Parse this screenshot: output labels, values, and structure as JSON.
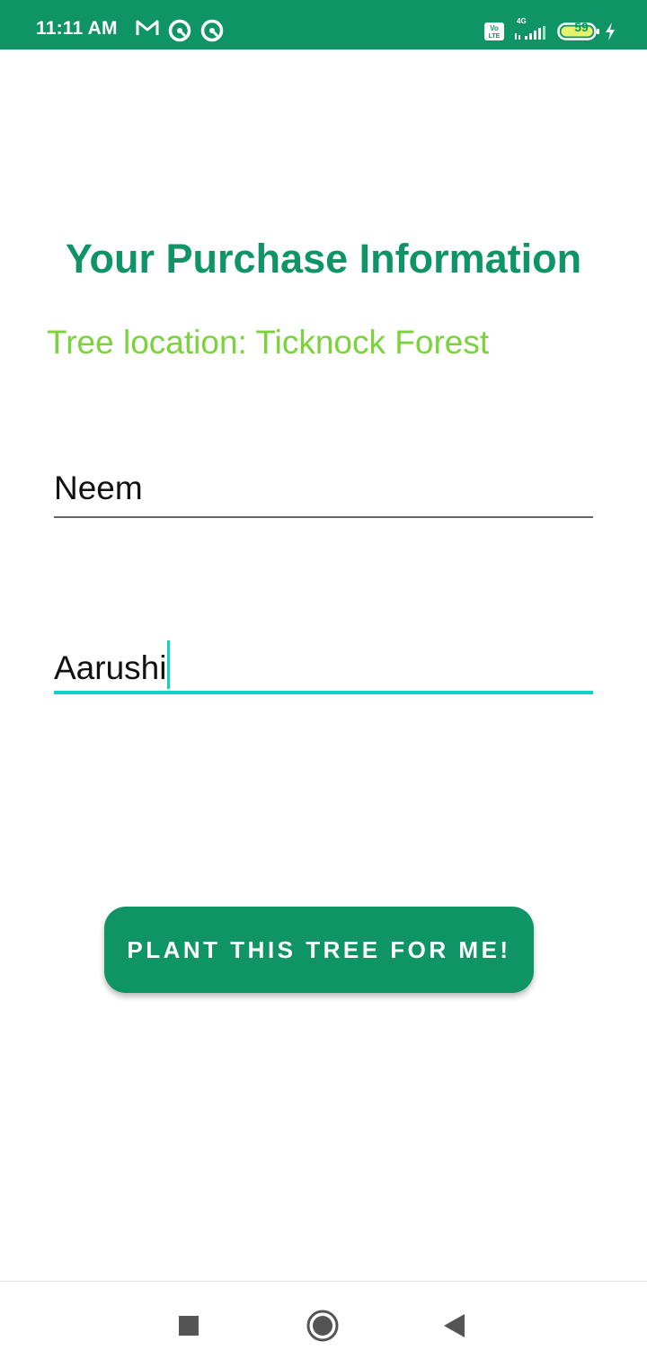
{
  "status_bar": {
    "time": "11:11 AM",
    "icons": [
      "gmail-icon",
      "vpn-icon",
      "vpn-icon"
    ],
    "network_label": "4G",
    "battery_level": "59",
    "background_color": "#0F9565"
  },
  "main": {
    "title": "Your Purchase Information",
    "location": "Tree location: Ticknock Forest",
    "tree_field_value": "Neem",
    "name_field_value": "Aarushi",
    "plant_button_label": "PLANT THIS TREE FOR ME!"
  },
  "colors": {
    "primary": "#0F9565",
    "accent_green": "#7AD33A",
    "focus_teal": "#14CFC6"
  },
  "nav_bar": {
    "buttons": [
      "recents-square-icon",
      "home-circle-icon",
      "back-triangle-icon"
    ]
  }
}
